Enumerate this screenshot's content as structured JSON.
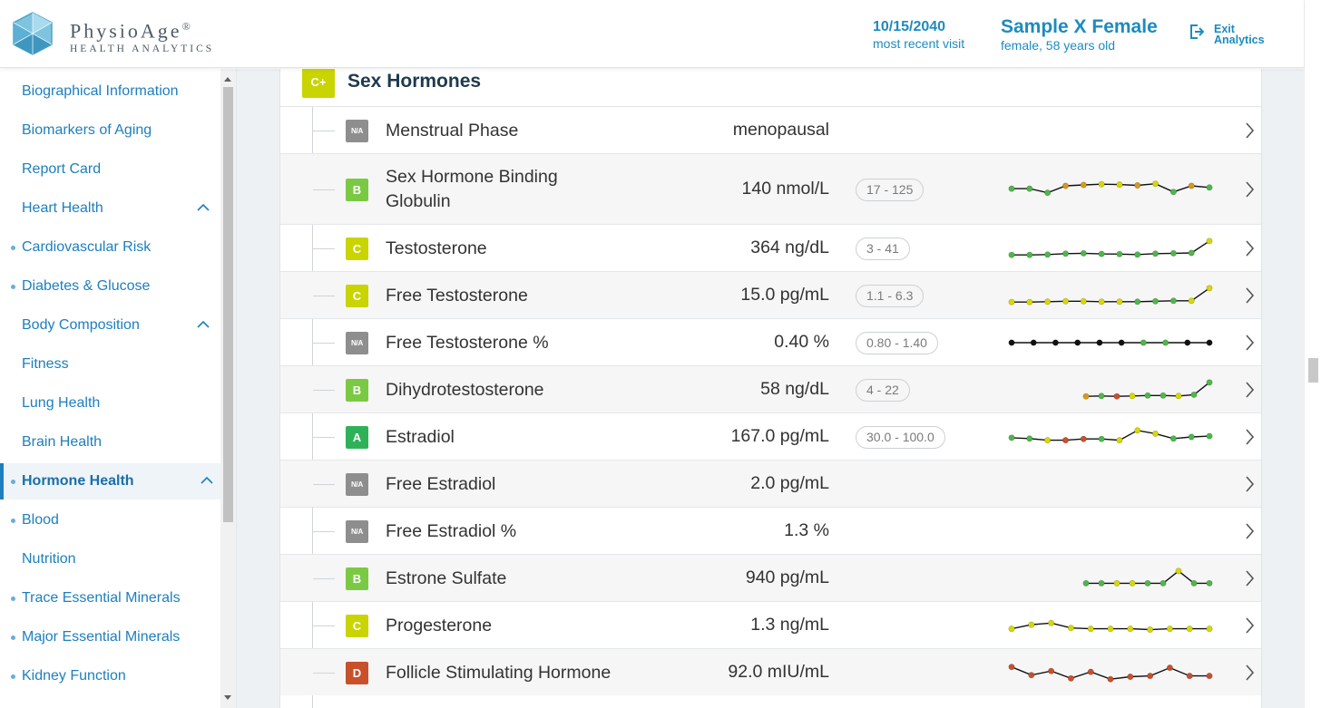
{
  "header": {
    "brand_name": "PhysioAge",
    "brand_reg": "®",
    "brand_subtitle": "HEALTH ANALYTICS",
    "visit_date": "10/15/2040",
    "visit_label": "most recent visit",
    "patient_name": "Sample X Female",
    "patient_info": "female, 58 years old",
    "exit_line1": "Exit",
    "exit_line2": "Analytics"
  },
  "sidebar": {
    "items": [
      {
        "label": "Biographical Information",
        "dot": false,
        "chevron": false,
        "active": false
      },
      {
        "label": "Biomarkers of Aging",
        "dot": false,
        "chevron": false,
        "active": false
      },
      {
        "label": "Report Card",
        "dot": false,
        "chevron": false,
        "active": false
      },
      {
        "label": "Heart Health",
        "dot": false,
        "chevron": true,
        "active": false
      },
      {
        "label": "Cardiovascular Risk",
        "dot": true,
        "chevron": false,
        "active": false
      },
      {
        "label": "Diabetes & Glucose",
        "dot": true,
        "chevron": false,
        "active": false
      },
      {
        "label": "Body Composition",
        "dot": false,
        "chevron": true,
        "active": false
      },
      {
        "label": "Fitness",
        "dot": false,
        "chevron": false,
        "active": false
      },
      {
        "label": "Lung Health",
        "dot": false,
        "chevron": false,
        "active": false
      },
      {
        "label": "Brain Health",
        "dot": false,
        "chevron": false,
        "active": false
      },
      {
        "label": "Hormone Health",
        "dot": true,
        "chevron": true,
        "active": true
      },
      {
        "label": "Blood",
        "dot": true,
        "chevron": false,
        "active": false
      },
      {
        "label": "Nutrition",
        "dot": false,
        "chevron": false,
        "active": false
      },
      {
        "label": "Trace Essential Minerals",
        "dot": true,
        "chevron": false,
        "active": false
      },
      {
        "label": "Major Essential Minerals",
        "dot": true,
        "chevron": false,
        "active": false
      },
      {
        "label": "Kidney Function",
        "dot": true,
        "chevron": false,
        "active": false
      }
    ]
  },
  "section": {
    "grade": "C+",
    "title": "Sex Hormones"
  },
  "colors": {
    "accent": "#1d7fbe",
    "grade_A": "#2fb15a",
    "grade_B": "#7ac943",
    "grade_C": "#c9d400",
    "grade_D": "#c8502a",
    "grade_NA": "#8e8e8e",
    "dot_green": "#4cb848",
    "dot_yellow": "#d8d800",
    "dot_orange": "#d69a1c",
    "dot_red": "#c8502a",
    "dot_black": "#111111"
  },
  "rows": [
    {
      "grade": "N/A",
      "name": "Menstrual Phase",
      "value": "menopausal",
      "range": "",
      "trend": []
    },
    {
      "grade": "B",
      "name": "Sex Hormone Binding Globulin",
      "value": "140 nmol/L",
      "range": "17 - 125",
      "trend": [
        {
          "v": 0.55,
          "c": "green"
        },
        {
          "v": 0.55,
          "c": "green"
        },
        {
          "v": 0.3,
          "c": "green"
        },
        {
          "v": 0.72,
          "c": "orange"
        },
        {
          "v": 0.78,
          "c": "orange"
        },
        {
          "v": 0.82,
          "c": "yellow"
        },
        {
          "v": 0.8,
          "c": "yellow"
        },
        {
          "v": 0.75,
          "c": "orange"
        },
        {
          "v": 0.85,
          "c": "yellow"
        },
        {
          "v": 0.35,
          "c": "green"
        },
        {
          "v": 0.72,
          "c": "orange"
        },
        {
          "v": 0.62,
          "c": "green"
        }
      ]
    },
    {
      "grade": "C",
      "name": "Testosterone",
      "value": "364 ng/dL",
      "range": "3 - 41",
      "trend": [
        {
          "v": 0.1,
          "c": "green"
        },
        {
          "v": 0.1,
          "c": "green"
        },
        {
          "v": 0.12,
          "c": "green"
        },
        {
          "v": 0.18,
          "c": "green"
        },
        {
          "v": 0.2,
          "c": "green"
        },
        {
          "v": 0.16,
          "c": "green"
        },
        {
          "v": 0.15,
          "c": "green"
        },
        {
          "v": 0.12,
          "c": "green"
        },
        {
          "v": 0.18,
          "c": "green"
        },
        {
          "v": 0.2,
          "c": "green"
        },
        {
          "v": 0.22,
          "c": "green"
        },
        {
          "v": 0.95,
          "c": "yellow"
        }
      ]
    },
    {
      "grade": "C",
      "name": "Free Testosterone",
      "value": "15.0 pg/mL",
      "range": "1.1 - 6.3",
      "trend": [
        {
          "v": 0.1,
          "c": "yellow"
        },
        {
          "v": 0.1,
          "c": "yellow"
        },
        {
          "v": 0.12,
          "c": "yellow"
        },
        {
          "v": 0.15,
          "c": "yellow"
        },
        {
          "v": 0.15,
          "c": "yellow"
        },
        {
          "v": 0.12,
          "c": "yellow"
        },
        {
          "v": 0.12,
          "c": "yellow"
        },
        {
          "v": 0.12,
          "c": "green"
        },
        {
          "v": 0.15,
          "c": "green"
        },
        {
          "v": 0.18,
          "c": "green"
        },
        {
          "v": 0.18,
          "c": "yellow"
        },
        {
          "v": 0.95,
          "c": "yellow"
        }
      ]
    },
    {
      "grade": "N/A",
      "name": "Free Testosterone %",
      "value": "0.40 %",
      "range": "0.80 - 1.40",
      "trend": [
        {
          "v": 0.5,
          "c": "black"
        },
        {
          "v": 0.5,
          "c": "black"
        },
        {
          "v": 0.5,
          "c": "black"
        },
        {
          "v": 0.5,
          "c": "black"
        },
        {
          "v": 0.5,
          "c": "black"
        },
        {
          "v": 0.5,
          "c": "black"
        },
        {
          "v": 0.5,
          "c": "green"
        },
        {
          "v": 0.5,
          "c": "green"
        },
        {
          "v": 0.5,
          "c": "black"
        },
        {
          "v": 0.5,
          "c": "black"
        }
      ]
    },
    {
      "grade": "B",
      "name": "Dihydrotestosterone",
      "value": "58 ng/dL",
      "range": "4 - 22",
      "trend": [
        {
          "v": 0.1,
          "c": "orange"
        },
        {
          "v": 0.12,
          "c": "green"
        },
        {
          "v": 0.1,
          "c": "red"
        },
        {
          "v": 0.12,
          "c": "yellow"
        },
        {
          "v": 0.15,
          "c": "green"
        },
        {
          "v": 0.15,
          "c": "green"
        },
        {
          "v": 0.12,
          "c": "yellow"
        },
        {
          "v": 0.2,
          "c": "green"
        },
        {
          "v": 0.95,
          "c": "green"
        }
      ]
    },
    {
      "grade": "A",
      "name": "Estradiol",
      "value": "167.0 pg/mL",
      "range": "30.0 - 100.0",
      "trend": [
        {
          "v": 0.45,
          "c": "green"
        },
        {
          "v": 0.4,
          "c": "green"
        },
        {
          "v": 0.3,
          "c": "yellow"
        },
        {
          "v": 0.3,
          "c": "red"
        },
        {
          "v": 0.38,
          "c": "red"
        },
        {
          "v": 0.38,
          "c": "green"
        },
        {
          "v": 0.3,
          "c": "yellow"
        },
        {
          "v": 0.9,
          "c": "yellow"
        },
        {
          "v": 0.7,
          "c": "yellow"
        },
        {
          "v": 0.4,
          "c": "green"
        },
        {
          "v": 0.5,
          "c": "green"
        },
        {
          "v": 0.55,
          "c": "green"
        }
      ]
    },
    {
      "grade": "N/A",
      "name": "Free Estradiol",
      "value": "2.0 pg/mL",
      "range": "",
      "trend": []
    },
    {
      "grade": "N/A",
      "name": "Free Estradiol %",
      "value": "1.3 %",
      "range": "",
      "trend": []
    },
    {
      "grade": "B",
      "name": "Estrone Sulfate",
      "value": "940 pg/mL",
      "range": "",
      "trend": [
        {
          "v": 0.2,
          "c": "green"
        },
        {
          "v": 0.2,
          "c": "green"
        },
        {
          "v": 0.2,
          "c": "yellow"
        },
        {
          "v": 0.2,
          "c": "yellow"
        },
        {
          "v": 0.2,
          "c": "green"
        },
        {
          "v": 0.2,
          "c": "green"
        },
        {
          "v": 0.95,
          "c": "yellow"
        },
        {
          "v": 0.2,
          "c": "green"
        },
        {
          "v": 0.2,
          "c": "green"
        }
      ]
    },
    {
      "grade": "C",
      "name": "Progesterone",
      "value": "1.3 ng/mL",
      "range": "",
      "trend": [
        {
          "v": 0.3,
          "c": "yellow"
        },
        {
          "v": 0.55,
          "c": "yellow"
        },
        {
          "v": 0.65,
          "c": "yellow"
        },
        {
          "v": 0.35,
          "c": "yellow"
        },
        {
          "v": 0.3,
          "c": "yellow"
        },
        {
          "v": 0.3,
          "c": "yellow"
        },
        {
          "v": 0.3,
          "c": "yellow"
        },
        {
          "v": 0.25,
          "c": "yellow"
        },
        {
          "v": 0.3,
          "c": "yellow"
        },
        {
          "v": 0.3,
          "c": "yellow"
        },
        {
          "v": 0.3,
          "c": "yellow"
        }
      ]
    },
    {
      "grade": "D",
      "name": "Follicle Stimulating Hormone",
      "value": "92.0 mIU/mL",
      "range": "",
      "trend": [
        {
          "v": 0.85,
          "c": "red"
        },
        {
          "v": 0.35,
          "c": "red"
        },
        {
          "v": 0.6,
          "c": "red"
        },
        {
          "v": 0.15,
          "c": "red"
        },
        {
          "v": 0.55,
          "c": "red"
        },
        {
          "v": 0.1,
          "c": "red"
        },
        {
          "v": 0.25,
          "c": "red"
        },
        {
          "v": 0.3,
          "c": "red"
        },
        {
          "v": 0.8,
          "c": "red"
        },
        {
          "v": 0.3,
          "c": "red"
        },
        {
          "v": 0.3,
          "c": "red"
        }
      ]
    }
  ]
}
